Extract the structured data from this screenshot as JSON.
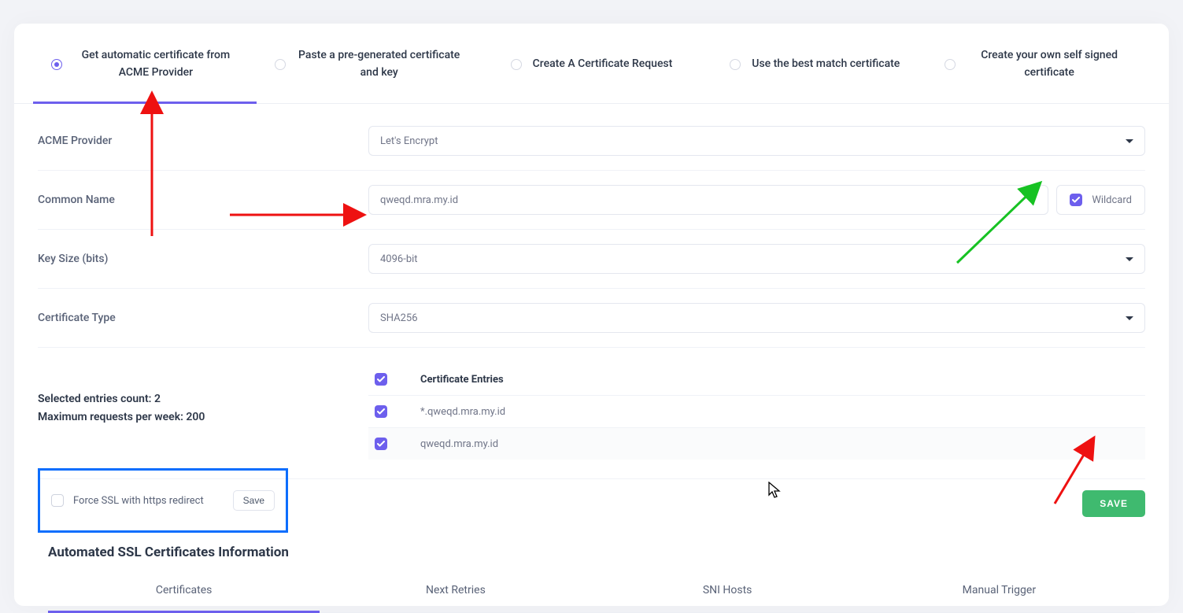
{
  "tabs": {
    "options": [
      "Get automatic certificate from ACME Provider",
      "Paste a pre-generated certificate and key",
      "Create A Certificate Request",
      "Use the best match certificate",
      "Create your own self signed certificate"
    ],
    "selected_index": 0
  },
  "form": {
    "acme_provider": {
      "label": "ACME Provider",
      "value": "Let's Encrypt"
    },
    "common_name": {
      "label": "Common Name",
      "value": "qweqd.mra.my.id",
      "wildcard_label": "Wildcard",
      "wildcard_checked": true
    },
    "key_size": {
      "label": "Key Size (bits)",
      "value": "4096-bit"
    },
    "cert_type": {
      "label": "Certificate Type",
      "value": "SHA256"
    }
  },
  "entries": {
    "count_text": "Selected entries count: 2",
    "max_text": "Maximum requests per week: 200",
    "header": "Certificate Entries",
    "items": [
      {
        "checked": true,
        "domain": "*.qweqd.mra.my.id"
      },
      {
        "checked": true,
        "domain": "qweqd.mra.my.id"
      }
    ]
  },
  "actions": {
    "save": "SAVE"
  },
  "force_ssl": {
    "label": "Force SSL with https redirect",
    "checked": false,
    "save": "Save"
  },
  "section_title": "Automated SSL Certificates Information",
  "bottom_tabs": {
    "items": [
      "Certificates",
      "Next Retries",
      "SNI Hosts",
      "Manual Trigger"
    ],
    "selected_index": 0
  }
}
